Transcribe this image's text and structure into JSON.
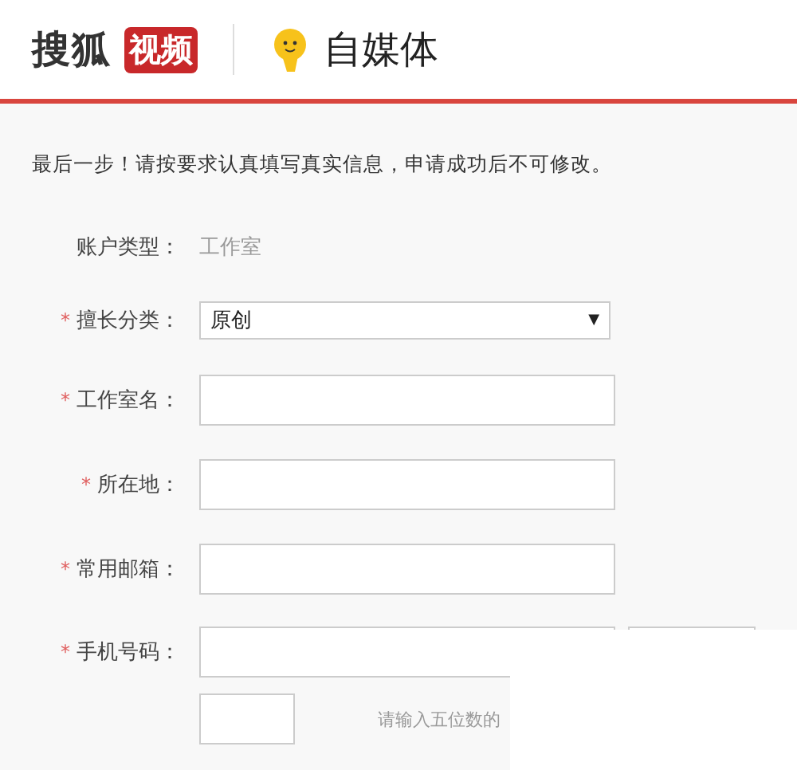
{
  "header": {
    "brand": "搜狐",
    "brand_badge": "视频",
    "product": "自媒体"
  },
  "intro": "最后一步！请按要求认真填写真实信息，申请成功后不可修改。",
  "fields": [
    {
      "kind": "static",
      "label": "账户类型：",
      "value": "工作室"
    },
    {
      "kind": "select",
      "required_mark": "*",
      "label": "擅长分类：",
      "value": "原创",
      "caret": "▼"
    },
    {
      "kind": "input",
      "required_mark": "*",
      "label": "工作室名："
    },
    {
      "kind": "input",
      "required_mark": "*",
      "label": "所在地："
    },
    {
      "kind": "input",
      "required_mark": "*",
      "label": "常用邮箱："
    },
    {
      "kind": "phone",
      "required_mark": "*",
      "label": "手机号码："
    },
    {
      "kind": "code",
      "hint": "请输入五位数的"
    }
  ]
}
